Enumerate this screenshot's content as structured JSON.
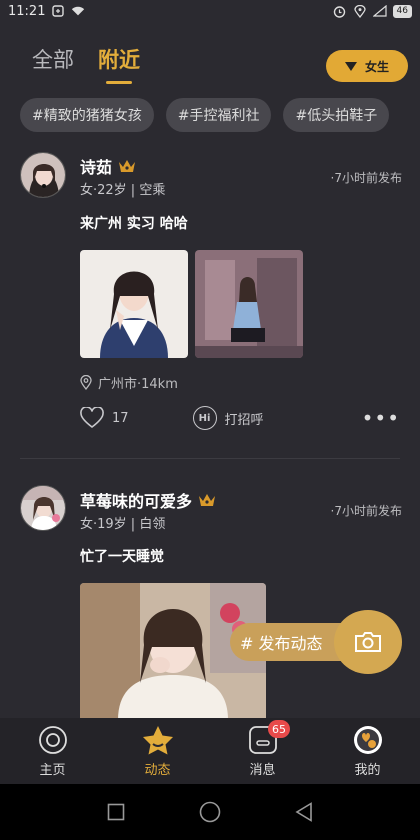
{
  "status_bar": {
    "time": "11:21",
    "battery": "46"
  },
  "header": {
    "tabs": [
      {
        "label": "全部"
      },
      {
        "label": "附近"
      }
    ],
    "active_tab": "附近",
    "filter_label": "女生"
  },
  "hashtags": [
    "#精致的猪猪女孩",
    "#手控福利社",
    "#低头拍鞋子"
  ],
  "posts": [
    {
      "name": "诗茹",
      "meta": "女·22岁 | 空乘",
      "time": "·7小时前发布",
      "content": "来广州 实习  哈哈",
      "location": "广州市·14km",
      "likes": "17",
      "greet_label": "打招呼",
      "hi_label": "Hi"
    },
    {
      "name": "草莓味的可爱多",
      "meta": "女·19岁 | 白领",
      "time": "·7小时前发布",
      "content": "忙了一天睡觉"
    }
  ],
  "publish": {
    "label": "# 发布动态"
  },
  "bottom_nav": [
    {
      "label": "主页",
      "icon": "home-circle-icon"
    },
    {
      "label": "动态",
      "icon": "star-feed-icon"
    },
    {
      "label": "消息",
      "icon": "message-icon",
      "badge": "65"
    },
    {
      "label": "我的",
      "icon": "profile-avatar-icon"
    }
  ],
  "colors": {
    "accent": "#e3ad3b",
    "background": "#2b2a30",
    "badge": "#e84a4a"
  }
}
